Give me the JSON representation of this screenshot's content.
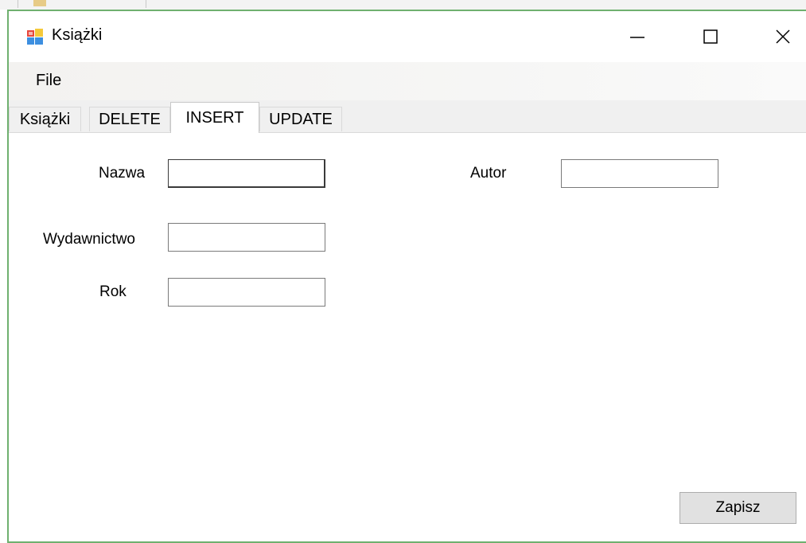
{
  "window": {
    "title": "Książki",
    "controls": {
      "minimize_icon": "minimize-icon",
      "maximize_icon": "maximize-icon",
      "close_icon": "close-icon"
    }
  },
  "menu": {
    "items": [
      {
        "label": "File"
      }
    ]
  },
  "tabs": [
    {
      "label": "Książki",
      "active": false
    },
    {
      "label": "DELETE",
      "active": false
    },
    {
      "label": "INSERT",
      "active": true
    },
    {
      "label": "UPDATE",
      "active": false
    }
  ],
  "form": {
    "nazwa_label": "Nazwa",
    "autor_label": "Autor",
    "wydawnictwo_label": "Wydawnictwo",
    "rok_label": "Rok",
    "nazwa_value": "",
    "autor_value": "",
    "wydawnictwo_value": "",
    "rok_value": "",
    "save_label": "Zapisz"
  },
  "colors": {
    "window_border": "#6fb06f",
    "tab_bg": "#f0f0f0",
    "button_bg": "#e1e1e1"
  }
}
